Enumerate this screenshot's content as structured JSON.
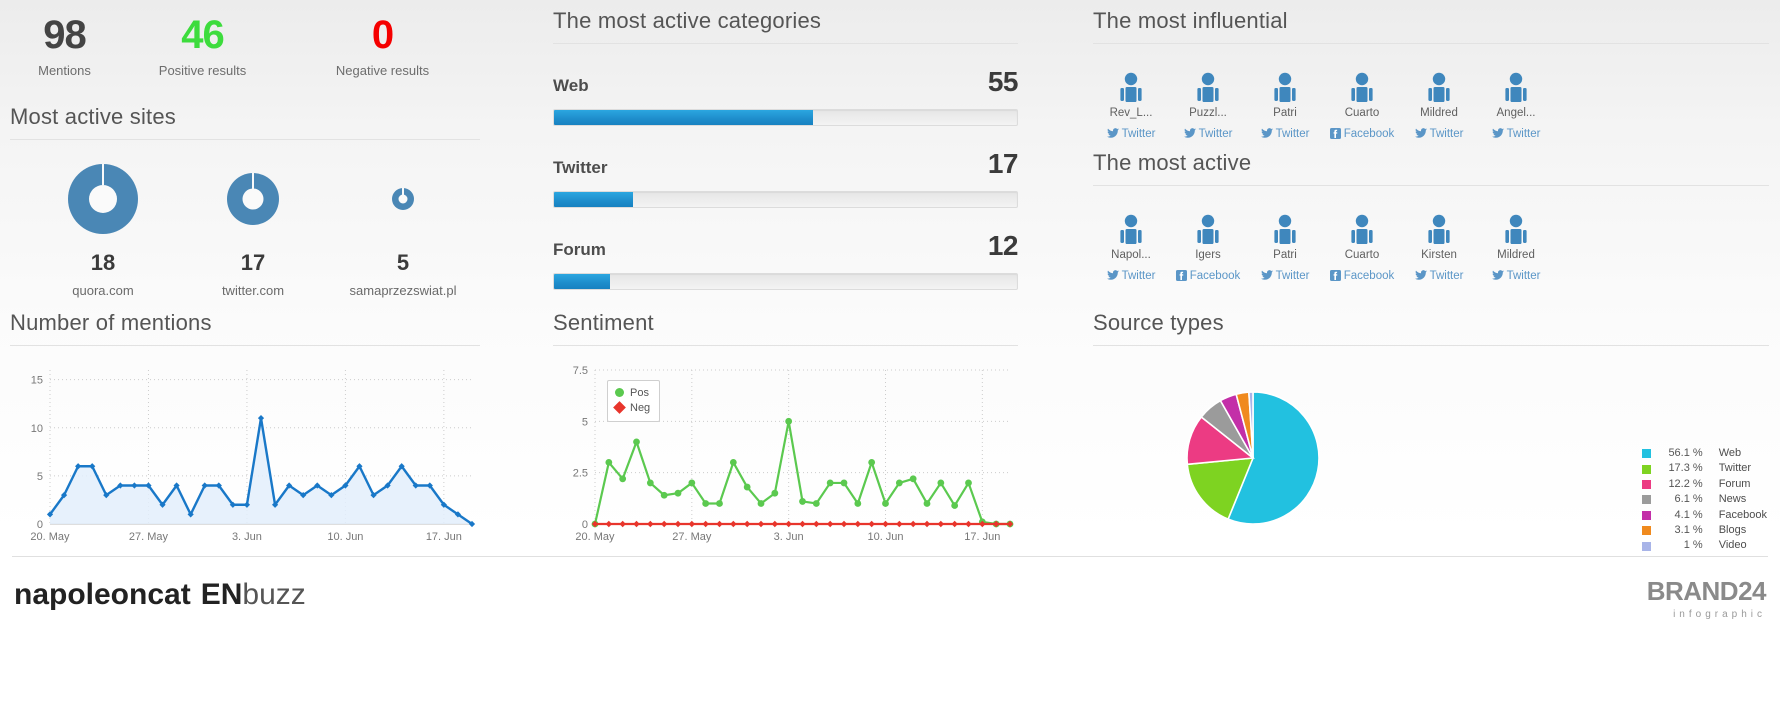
{
  "kpis": [
    {
      "value": "98",
      "label": "Mentions",
      "color": "#3b3b3b"
    },
    {
      "value": "46",
      "label": "Positive results",
      "color": "#3ddc3d"
    },
    {
      "value": "0",
      "label": "Negative results",
      "color": "#f50000"
    }
  ],
  "most_active_sites": {
    "title": "Most active sites",
    "items": [
      {
        "count": "18",
        "domain": "quora.com",
        "size": 70
      },
      {
        "count": "17",
        "domain": "twitter.com",
        "size": 52
      },
      {
        "count": "5",
        "domain": "samaprzezswiat.pl",
        "size": 22
      }
    ]
  },
  "categories": {
    "title": "The most active categories",
    "items": [
      {
        "name": "Web",
        "value": "55",
        "percent": 56
      },
      {
        "name": "Twitter",
        "value": "17",
        "percent": 17
      },
      {
        "name": "Forum",
        "value": "12",
        "percent": 12
      }
    ]
  },
  "most_influential": {
    "title": "The most influential",
    "people": [
      {
        "name": "Rev_L...",
        "network": "Twitter"
      },
      {
        "name": "Puzzl...",
        "network": "Twitter"
      },
      {
        "name": "Patri",
        "network": "Twitter"
      },
      {
        "name": "Cuarto",
        "network": "Facebook"
      },
      {
        "name": "Mildred",
        "network": "Twitter"
      },
      {
        "name": "Angel...",
        "network": "Twitter"
      }
    ]
  },
  "most_active_people": {
    "title": "The most active",
    "people": [
      {
        "name": "Napol...",
        "network": "Twitter"
      },
      {
        "name": "Igers",
        "network": "Facebook"
      },
      {
        "name": "Patri",
        "network": "Twitter"
      },
      {
        "name": "Cuarto",
        "network": "Facebook"
      },
      {
        "name": "Kirsten",
        "network": "Twitter"
      },
      {
        "name": "Mildred",
        "network": "Twitter"
      }
    ]
  },
  "chart_data": [
    {
      "type": "area",
      "title": "Number of mentions",
      "xlabel": "",
      "ylabel": "",
      "ylim": [
        0,
        16
      ],
      "yticks": [
        0,
        5,
        10,
        15
      ],
      "grid": true,
      "legend": "none",
      "line_color": "#1978c8",
      "fill_color": "#e3eefb",
      "xtick_labels": [
        "20. May",
        "27. May",
        "3. Jun",
        "10. Jun",
        "17. Jun"
      ],
      "x": [
        "20. May",
        "21. May",
        "22. May",
        "23. May",
        "24. May",
        "25. May",
        "26. May",
        "27. May",
        "28. May",
        "29. May",
        "30. May",
        "31. May",
        "1. Jun",
        "2. Jun",
        "3. Jun",
        "4. Jun",
        "5. Jun",
        "6. Jun",
        "7. Jun",
        "8. Jun",
        "9. Jun",
        "10. Jun",
        "11. Jun",
        "12. Jun",
        "13. Jun",
        "14. Jun",
        "15. Jun",
        "16. Jun",
        "17. Jun",
        "18. Jun",
        "19. Jun"
      ],
      "values": [
        1,
        3,
        6,
        6,
        3,
        4,
        4,
        4,
        2,
        4,
        1,
        4,
        4,
        2,
        2,
        11,
        2,
        4,
        3,
        4,
        3,
        4,
        6,
        3,
        4,
        6,
        4,
        4,
        2,
        1,
        0
      ]
    },
    {
      "type": "line",
      "title": "Sentiment",
      "xlabel": "",
      "ylabel": "",
      "ylim": [
        0,
        7.5
      ],
      "yticks": [
        0,
        2.5,
        5,
        7.5
      ],
      "grid": true,
      "legend": "top-left",
      "xtick_labels": [
        "20. May",
        "27. May",
        "3. Jun",
        "10. Jun",
        "17. Jun"
      ],
      "x": [
        "20. May",
        "21. May",
        "22. May",
        "23. May",
        "24. May",
        "25. May",
        "26. May",
        "27. May",
        "28. May",
        "29. May",
        "30. May",
        "31. May",
        "1. Jun",
        "2. Jun",
        "3. Jun",
        "4. Jun",
        "5. Jun",
        "6. Jun",
        "7. Jun",
        "8. Jun",
        "9. Jun",
        "10. Jun",
        "11. Jun",
        "12. Jun",
        "13. Jun",
        "14. Jun",
        "15. Jun",
        "16. Jun",
        "17. Jun",
        "18. Jun",
        "19. Jun"
      ],
      "series": [
        {
          "name": "Pos",
          "color": "#5bc94f",
          "values": [
            0,
            3,
            2.2,
            4,
            2,
            1.4,
            1.5,
            2,
            1,
            1,
            3,
            1.8,
            1,
            1.5,
            5,
            1.1,
            1,
            2,
            2,
            1,
            3,
            1,
            2,
            2.2,
            1,
            2,
            0.9,
            2,
            0.1,
            0,
            0
          ]
        },
        {
          "name": "Neg",
          "color": "#e8352c",
          "values": [
            0,
            0,
            0,
            0,
            0,
            0,
            0,
            0,
            0,
            0,
            0,
            0,
            0,
            0,
            0,
            0,
            0,
            0,
            0,
            0,
            0,
            0,
            0,
            0,
            0,
            0,
            0,
            0,
            0,
            0,
            0
          ]
        }
      ]
    },
    {
      "type": "pie",
      "title": "Source types",
      "legend": "right",
      "labels": [
        "Web",
        "Twitter",
        "Forum",
        "News",
        "Facebook",
        "Blogs",
        "Video"
      ],
      "values": [
        56.1,
        17.3,
        12.2,
        6.1,
        4.1,
        3.1,
        1
      ],
      "percent_labels": [
        "56.1 %",
        "17.3 %",
        "12.2 %",
        "6.1 %",
        "4.1 %",
        "3.1 %",
        "1 %"
      ],
      "colors": [
        "#22c1e0",
        "#7ed321",
        "#ec3b83",
        "#9b9b9b",
        "#c32fa8",
        "#f08a1e",
        "#a8b4e8"
      ]
    }
  ],
  "footer": {
    "left_bold": "napoleoncat",
    "left_en": "EN",
    "left_buzz": "buzz",
    "right_brand": "BRAND24",
    "right_sub": "infographic"
  },
  "icons": {
    "twitter": "twitter-bird-icon",
    "facebook": "facebook-f-icon",
    "person": "person-avatar-icon",
    "donut": "donut-chart-icon"
  }
}
